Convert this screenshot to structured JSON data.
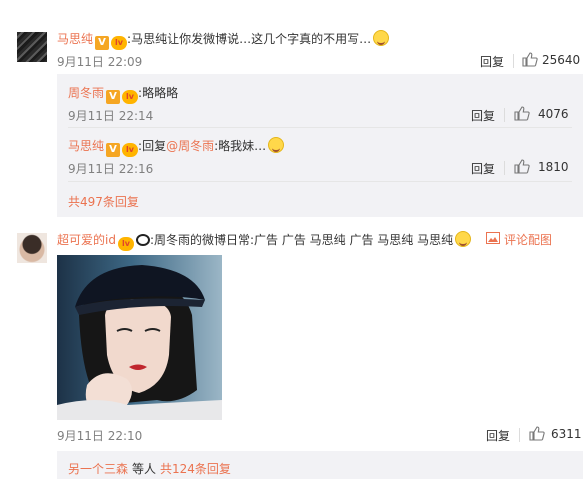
{
  "comment1": {
    "username": "马思纯",
    "separator": ":",
    "text": "马思纯让你发微博说…这几个字真的不用写…",
    "time": "9月11日 22:09",
    "reply_label": "回复",
    "likes": "25640",
    "replies": [
      {
        "username": "周冬雨",
        "separator": ":",
        "text": "略略略",
        "time": "9月11日 22:14",
        "reply_label": "回复",
        "likes": "4076"
      },
      {
        "username": "马思纯",
        "separator": ":",
        "reply_prefix": "回复",
        "mention": "@周冬雨",
        "text": ":略我妹…",
        "time": "9月11日 22:16",
        "reply_label": "回复",
        "likes": "1810"
      }
    ],
    "more_replies": "共497条回复"
  },
  "comment2": {
    "username": "超可爱的id",
    "separator": ":",
    "text": "周冬雨的微博日常:广告 广告 马思纯 广告 马思纯 马思纯",
    "comment_pic_label": "评论配图",
    "time": "9月11日 22:10",
    "reply_label": "回复",
    "likes": "6311",
    "replies_user": "另一个三森",
    "replies_mid": "等人",
    "replies_count": "共124条回复"
  },
  "icons": {
    "vip": "V",
    "level": "lv"
  },
  "colors": {
    "link": "#eb7350",
    "muted": "#808080",
    "reply_bg": "#f2f2f5"
  }
}
